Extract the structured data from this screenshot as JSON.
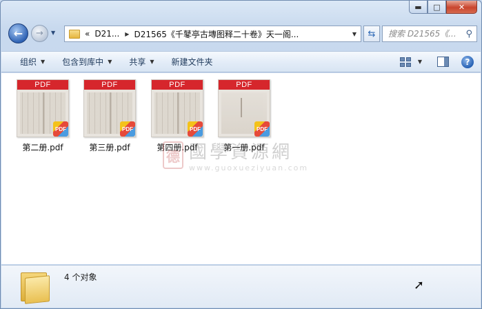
{
  "titlebar": {
    "minimize_label": "▬",
    "maximize_label": "□",
    "close_label": "✕"
  },
  "nav": {
    "back_glyph": "←",
    "forward_glyph": "→",
    "address_chevron": "«",
    "address_segments": [
      "D21...",
      "D21565《千鼕亭古塼图释二十卷》天一阁..."
    ],
    "search_placeholder": "搜索 D21565《...",
    "refresh_icon": "refresh-icon"
  },
  "toolbar": {
    "organize": "组织",
    "include_library": "包含到库中",
    "share": "共享",
    "new_folder": "新建文件夹"
  },
  "files": [
    {
      "name": "第二册.pdf",
      "thumb_label": "PDF",
      "badge": "PDF"
    },
    {
      "name": "第三册.pdf",
      "thumb_label": "PDF",
      "badge": "PDF"
    },
    {
      "name": "第四册.pdf",
      "thumb_label": "PDF",
      "badge": "PDF"
    },
    {
      "name": "第一册.pdf",
      "thumb_label": "PDF",
      "badge": "PDF"
    }
  ],
  "watermark": {
    "seal": "德",
    "title": "國學資源網",
    "url": "www.guoxueziyuan.com"
  },
  "status": {
    "count": "4 个对象"
  },
  "colors": {
    "pdf_red": "#d6262c",
    "close_red": "#c9452d",
    "accent_blue": "#2f63b5"
  }
}
